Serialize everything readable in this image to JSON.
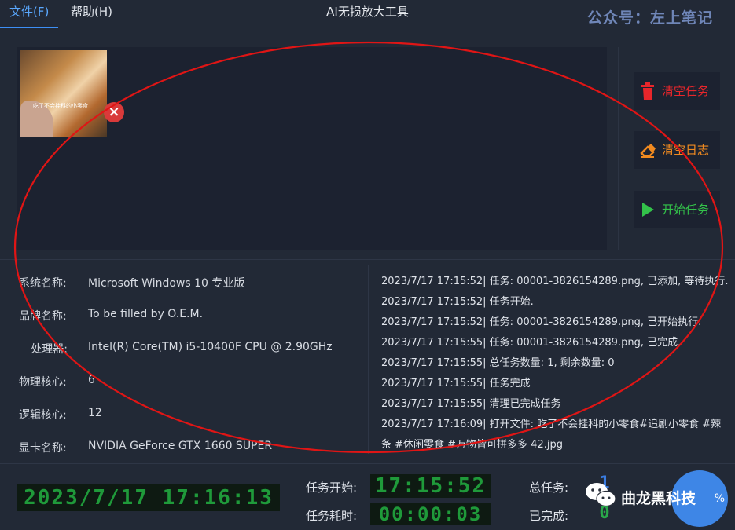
{
  "menu": {
    "file": "文件(F)",
    "help": "帮助(H)"
  },
  "window_title": "AI无损放大工具",
  "watermark": "公众号：左上笔记",
  "task": {
    "thumbnail_caption": "吃了不会挂科的小零食"
  },
  "actions": {
    "clear_tasks": "清空任务",
    "clear_log": "清空日志",
    "start_task": "开始任务",
    "colors": {
      "clear_tasks": "#e8262b",
      "clear_log": "#f08a20",
      "start_task": "#33c24a"
    }
  },
  "system_info": [
    {
      "key": "系统名称:",
      "value": "Microsoft Windows 10 专业版"
    },
    {
      "key": "品牌名称:",
      "value": "To be filled by O.E.M."
    },
    {
      "key": "处理器:",
      "value": "Intel(R) Core(TM) i5-10400F CPU @ 2.90GHz"
    },
    {
      "key": "物理核心:",
      "value": "6"
    },
    {
      "key": "逻辑核心:",
      "value": "12"
    },
    {
      "key": "显卡名称:",
      "value": "NVIDIA GeForce GTX 1660 SUPER"
    }
  ],
  "log": [
    "2023/7/17 17:15:52| 任务: 00001-3826154289.png, 已添加, 等待执行.",
    "2023/7/17 17:15:52| 任务开始.",
    "2023/7/17 17:15:52| 任务: 00001-3826154289.png, 已开始执行.",
    "2023/7/17 17:15:55| 任务: 00001-3826154289.png, 已完成.",
    "2023/7/17 17:15:55| 总任务数量: 1, 剩余数量: 0",
    "2023/7/17 17:15:55| 任务完成",
    "2023/7/17 17:15:55| 清理已完成任务",
    "2023/7/17 17:16:09| 打开文件: 吃了不会挂科的小零食#追剧小零食 #辣",
    "条 #休闲零食 #万物皆可拼多多 42.jpg"
  ],
  "footer": {
    "clock": "2023/7/17 17:16:13",
    "task_start_label": "任务开始:",
    "task_start_value": "17:15:52",
    "task_elapsed_label": "任务耗时:",
    "task_elapsed_value": "00:00:03",
    "total_label": "总任务:",
    "total_value": "1",
    "done_label": "已完成:",
    "done_value": "0",
    "progress_text": "%"
  },
  "brand": {
    "name": "曲龙黑科技"
  },
  "accent_color": "#3d8ff5",
  "annotation_color": "#e01515"
}
